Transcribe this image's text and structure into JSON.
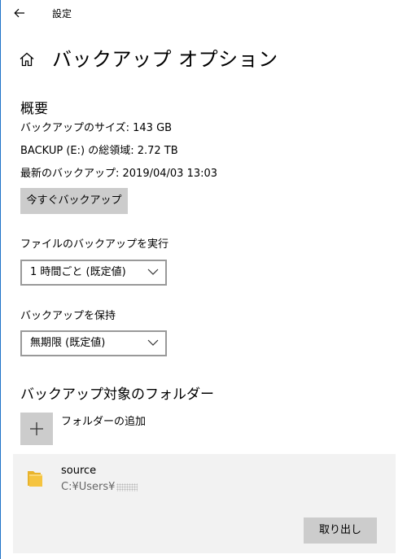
{
  "window": {
    "title": "設定",
    "back_icon": "arrow-left-icon"
  },
  "header": {
    "home_icon": "home-icon",
    "title": "バックアップ オプション"
  },
  "overview": {
    "heading": "概要",
    "backup_size": "バックアップのサイズ: 143 GB",
    "total_space": "BACKUP (E:) の総領域: 2.72 TB",
    "last_backup": "最新のバックアップ: 2019/04/03 13:03",
    "backup_now_label": "今すぐバックアップ"
  },
  "schedule": {
    "label": "ファイルのバックアップを実行",
    "selected": "1 時間ごと (既定値)"
  },
  "retention": {
    "label": "バックアップを保持",
    "selected": "無期限 (既定値)"
  },
  "folders": {
    "heading": "バックアップ対象のフォルダー",
    "add_label": "フォルダーの追加",
    "items": [
      {
        "name": "source",
        "path": "C:¥Users¥",
        "remove_label": "取り出し"
      }
    ]
  },
  "colors": {
    "accent_edge": "#1f73c8",
    "button_gray": "#cccccc",
    "panel_gray": "#f2f2f2",
    "folder_yellow": "#f5c440"
  }
}
